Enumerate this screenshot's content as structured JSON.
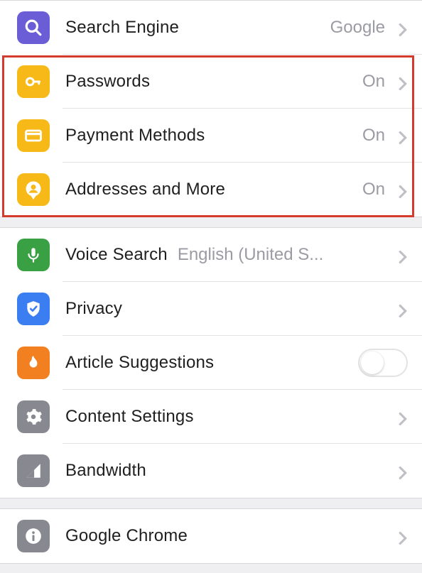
{
  "colors": {
    "purple": "#6b5dd6",
    "yellow": "#f6b917",
    "green": "#3aa044",
    "blue": "#3a7ef2",
    "orange": "#f28020",
    "gray": "#888890"
  },
  "section1": {
    "searchEngine": {
      "label": "Search Engine",
      "value": "Google"
    },
    "passwords": {
      "label": "Passwords",
      "value": "On"
    },
    "payment": {
      "label": "Payment Methods",
      "value": "On"
    },
    "addresses": {
      "label": "Addresses and More",
      "value": "On"
    }
  },
  "section2": {
    "voiceSearch": {
      "label": "Voice Search",
      "value": "English (United S..."
    },
    "privacy": {
      "label": "Privacy"
    },
    "articleSugg": {
      "label": "Article Suggestions",
      "toggle": false
    },
    "contentSett": {
      "label": "Content Settings"
    },
    "bandwidth": {
      "label": "Bandwidth"
    }
  },
  "section3": {
    "googleChrome": {
      "label": "Google Chrome"
    }
  }
}
